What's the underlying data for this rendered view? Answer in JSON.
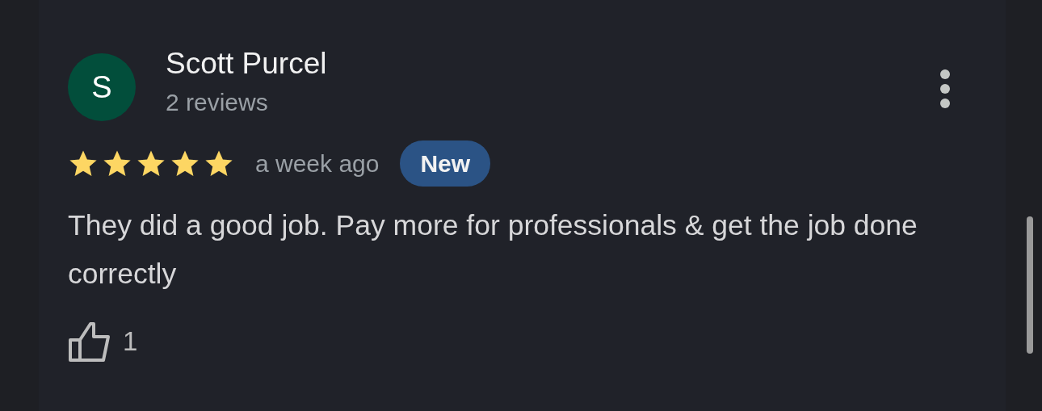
{
  "review": {
    "avatar_letter": "S",
    "author": "Scott Purcel",
    "author_meta": "2 reviews",
    "stars": 5,
    "time": "a week ago",
    "badge": "New",
    "text": "They did a good job. Pay more for professionals & get the job done correctly",
    "likes": "1"
  }
}
